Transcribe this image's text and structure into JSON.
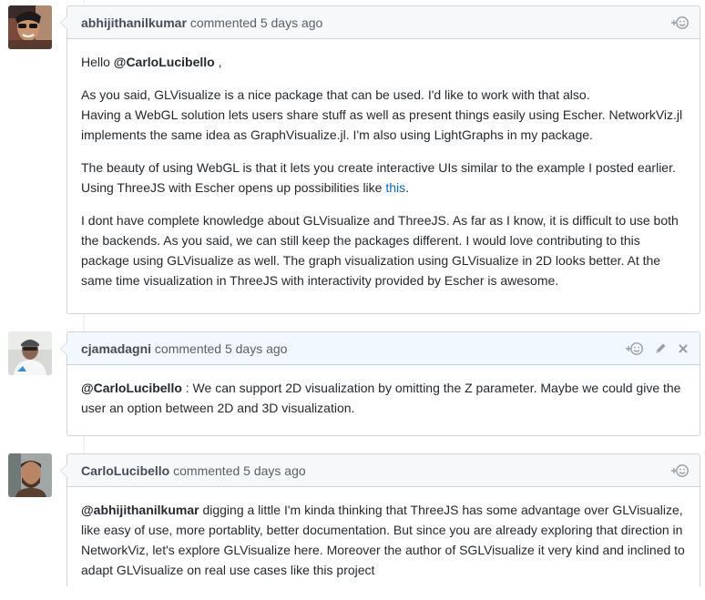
{
  "comments": [
    {
      "author": "abhijithanilkumar",
      "meta": "commented 5 days ago",
      "paragraphs": [
        {
          "greeting": "Hello ",
          "mention": "@CarloLucibello",
          "after": " ,"
        },
        {
          "line1": "As you said, GLVisualize is a nice package that can be used. I'd like to work with that also.",
          "line2": "Having a WebGL solution lets users share stuff as well as present things easily using Escher. NetworkViz.jl implements the same idea as GraphVisualize.jl. I'm also using LightGraphs in my package."
        },
        {
          "text": "The beauty of using WebGL is that it lets you create interactive UIs similar to the example I posted earlier. Using ThreeJS with Escher opens up possibilities like ",
          "link": "this",
          "after": "."
        },
        {
          "text": "I dont have complete knowledge about GLVisualize and ThreeJS. As far as I know, it is difficult to use both the backends. As you said, we can still keep the packages different. I would love contributing to this package using GLVisualize as well. The graph visualization using GLVisualize in 2D looks better. At the same time visualization in ThreeJS with interactivity provided by Escher is awesome."
        }
      ]
    },
    {
      "author": "cjamadagni",
      "meta": "commented 5 days ago",
      "mention": "@CarloLucibello",
      "text": " : We can support 2D visualization by omitting the Z parameter. Maybe we could give the user an option between 2D and 3D visualization."
    },
    {
      "author": "CarloLucibello",
      "meta": "commented 5 days ago",
      "mention": "@abhijithanilkumar",
      "text": " digging a little I'm kinda thinking that ThreeJS has some advantage over GLVisualize, like easy of use, more portablity, better documentation. But since you are already exploring that direction in NetworkViz, let's explore GLVisualize here. Moreover the author of SGLVisualize it very kind and inclined to adapt GLVisualize on real use cases like this project"
    }
  ],
  "icons": {
    "reaction": "add-reaction-icon",
    "edit": "pencil-icon",
    "delete": "close-icon"
  },
  "colors": {
    "link": "#0366d6",
    "header_bg": "#f6f8fa",
    "owner_header_bg": "#f1f8ff",
    "border": "#d1d5da"
  }
}
